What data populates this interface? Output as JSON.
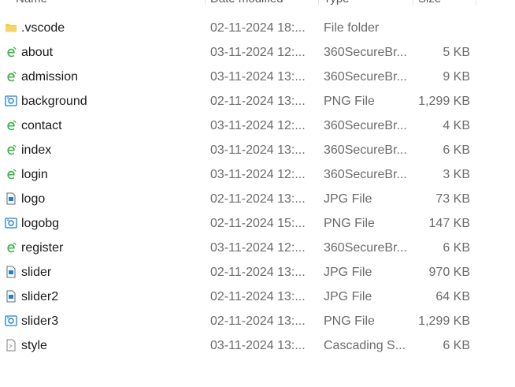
{
  "columns": {
    "name": "Name",
    "date": "Date modified",
    "type": "Type",
    "size": "Size"
  },
  "files": [
    {
      "name": ".vscode",
      "date": "02-11-2024 18:...",
      "type": "File folder",
      "size": "",
      "icon": "folder-icon"
    },
    {
      "name": "about",
      "date": "03-11-2024 12:...",
      "type": "360SecureBr...",
      "size": "5 KB",
      "icon": "browser-html-icon"
    },
    {
      "name": "admission",
      "date": "03-11-2024 13:...",
      "type": "360SecureBr...",
      "size": "9 KB",
      "icon": "browser-html-icon"
    },
    {
      "name": "background",
      "date": "02-11-2024 13:...",
      "type": "PNG File",
      "size": "1,299 KB",
      "icon": "image-png-icon"
    },
    {
      "name": "contact",
      "date": "03-11-2024 12:...",
      "type": "360SecureBr...",
      "size": "4 KB",
      "icon": "browser-html-icon"
    },
    {
      "name": "index",
      "date": "03-11-2024 13:...",
      "type": "360SecureBr...",
      "size": "6 KB",
      "icon": "browser-html-icon"
    },
    {
      "name": "login",
      "date": "03-11-2024 12:...",
      "type": "360SecureBr...",
      "size": "3 KB",
      "icon": "browser-html-icon"
    },
    {
      "name": "logo",
      "date": "02-11-2024 13:...",
      "type": "JPG File",
      "size": "73 KB",
      "icon": "image-jpg-icon"
    },
    {
      "name": "logobg",
      "date": "02-11-2024 15:...",
      "type": "PNG File",
      "size": "147 KB",
      "icon": "image-png-icon"
    },
    {
      "name": "register",
      "date": "03-11-2024 12:...",
      "type": "360SecureBr...",
      "size": "6 KB",
      "icon": "browser-html-icon"
    },
    {
      "name": "slider",
      "date": "02-11-2024 13:...",
      "type": "JPG File",
      "size": "970 KB",
      "icon": "image-jpg-icon"
    },
    {
      "name": "slider2",
      "date": "02-11-2024 13:...",
      "type": "JPG File",
      "size": "64 KB",
      "icon": "image-jpg-icon"
    },
    {
      "name": "slider3",
      "date": "02-11-2024 13:...",
      "type": "PNG File",
      "size": "1,299 KB",
      "icon": "image-png-icon"
    },
    {
      "name": "style",
      "date": "03-11-2024 13:...",
      "type": "Cascading S...",
      "size": "6 KB",
      "icon": "css-file-icon"
    }
  ],
  "colors": {
    "folder": "#f4c542",
    "browser": "#3cb54a",
    "image": "#1d7fd1",
    "text": "#1b1b1b",
    "muted": "#6b6b6b"
  }
}
